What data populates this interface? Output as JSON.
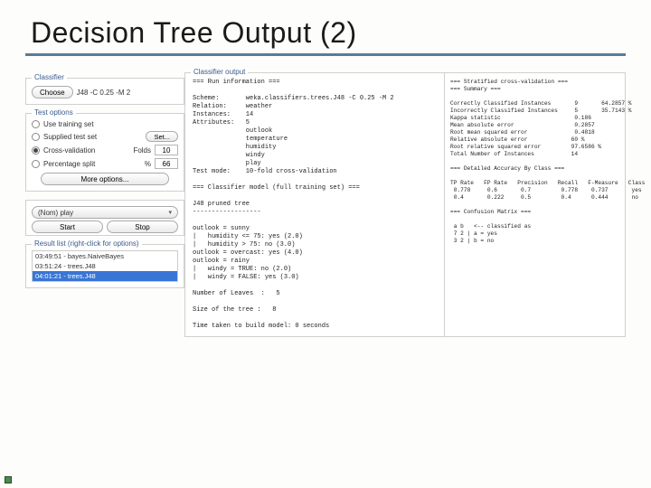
{
  "slide": {
    "title": "Decision Tree Output (2)"
  },
  "classifier": {
    "panel": "Classifier",
    "choose": "Choose",
    "string": "J48 -C 0.25 -M 2"
  },
  "test_options": {
    "panel": "Test options",
    "use_training": "Use training set",
    "supplied": "Supplied test set",
    "set_btn": "Set...",
    "cv": "Cross-validation",
    "folds_label": "Folds",
    "folds_value": "10",
    "pct": "Percentage split",
    "pct_label": "%",
    "pct_value": "66",
    "more": "More options..."
  },
  "class_attr": {
    "value": "(Nom) play"
  },
  "buttons": {
    "start": "Start",
    "stop": "Stop"
  },
  "result_list": {
    "panel": "Result list (right-click for options)",
    "items": [
      "03:49:51 - bayes.NaiveBayes",
      "03:51:24 - trees.J48",
      "04:01:21 - trees.J48"
    ],
    "selected": 2
  },
  "output": {
    "panel": "Classifier output",
    "text": "=== Run information ===\n\nScheme:       weka.classifiers.trees.J48 -C 0.25 -M 2\nRelation:     weather\nInstances:    14\nAttributes:   5\n              outlook\n              temperature\n              humidity\n              windy\n              play\nTest mode:    10-fold cross-validation\n\n=== Classifier model (full training set) ===\n\nJ48 pruned tree\n------------------\n\noutlook = sunny\n|   humidity <= 75: yes (2.0)\n|   humidity > 75: no (3.0)\noutlook = overcast: yes (4.0)\noutlook = rainy\n|   windy = TRUE: no (2.0)\n|   windy = FALSE: yes (3.0)\n\nNumber of Leaves  :   5\n\nSize of the tree :   8\n\nTime taken to build model: 0 seconds"
  },
  "stats": {
    "text": "=== Stratified cross-validation ===\n=== Summary ===\n\nCorrectly Classified Instances       9       64.2857 %\nIncorrectly Classified Instances     5       35.7143 %\nKappa statistic                      0.186\nMean absolute error                  0.2857\nRoot mean squared error              0.4818\nRelative absolute error             60 %\nRoot relative squared error         97.6586 %\nTotal Number of Instances           14\n\n=== Detailed Accuracy By Class ===\n\nTP Rate   FP Rate   Precision   Recall   F-Measure   Class\n 0.778     0.6       0.7         0.778    0.737       yes\n 0.4       0.222     0.5         0.4      0.444       no\n\n=== Confusion Matrix ===\n\n a b   <-- classified as\n 7 2 | a = yes\n 3 2 | b = no"
  }
}
